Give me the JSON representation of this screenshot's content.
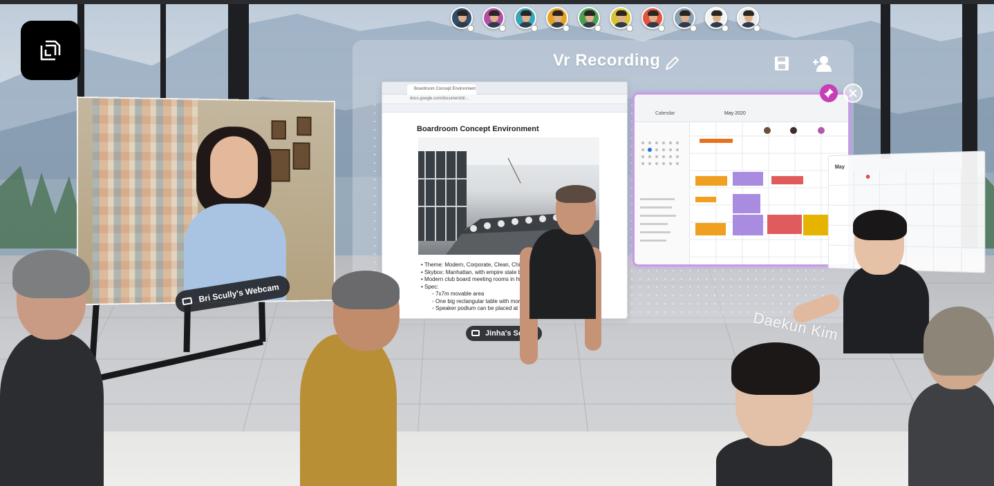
{
  "participants": [
    {
      "name": "participant-1",
      "shirt": "#2f4f6e"
    },
    {
      "name": "participant-2",
      "shirt": "#b14fa5"
    },
    {
      "name": "participant-3",
      "shirt": "#3aa4b8"
    },
    {
      "name": "participant-4",
      "shirt": "#e5a222"
    },
    {
      "name": "participant-5",
      "shirt": "#4c9e52"
    },
    {
      "name": "participant-6",
      "shirt": "#d8c432"
    },
    {
      "name": "participant-7",
      "shirt": "#e2553d"
    },
    {
      "name": "participant-8",
      "shirt": "#8aa2b4"
    },
    {
      "name": "participant-9",
      "shirt": "#f2f2f2"
    },
    {
      "name": "participant-10",
      "shirt": "#e9e9e9"
    }
  ],
  "recording": {
    "title": "Vr Recording"
  },
  "webcam": {
    "label": "Bri Scully's Webcam"
  },
  "screen_share": {
    "label": "Jinha's Scre",
    "tab_title": "Boardroom Concept Environment",
    "url": "docs.google.com/document/d/...",
    "doc_heading": "Boardroom Concept Environment",
    "bullets": [
      {
        "text": "Theme: Modern, Corporate, Clean, Chic.",
        "level": 0
      },
      {
        "text": "Skybox: Manhattan, with empire state bu",
        "level": 0
      },
      {
        "text": "Modern club board meeting rooms in hig",
        "level": 0
      },
      {
        "text": "Spec:",
        "level": 0
      },
      {
        "text": "7x7m movable area",
        "level": 1
      },
      {
        "text": "One big rectangular table with mon",
        "level": 1
      },
      {
        "text": "Speaker podium can be placed at t",
        "level": 1
      }
    ]
  },
  "calendar": {
    "brand": "Calendar",
    "month": "May 2020",
    "accent": "#c79be6"
  },
  "mini_calendar": {
    "title": "May"
  },
  "name_tag": {
    "text": "Daekun Kim"
  },
  "colors": {
    "label_bg": "#1e2024",
    "pin": "#c63fb4"
  }
}
